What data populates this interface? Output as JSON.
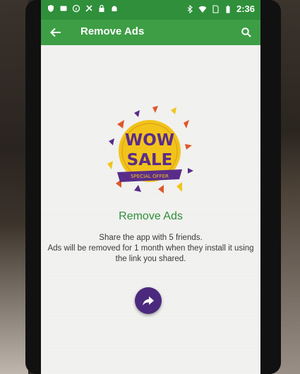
{
  "status_bar": {
    "time": "2:36",
    "left_icons": [
      "shield-icon",
      "message-icon",
      "info-icon",
      "blocked-icon",
      "lock-icon",
      "android-icon"
    ],
    "right_icons": [
      "bluetooth-icon",
      "wifi-icon",
      "no-sim-icon",
      "battery-icon"
    ]
  },
  "app_bar": {
    "title": "Remove Ads",
    "back_icon": "arrow-back-icon",
    "search_icon": "search-icon",
    "color": "#3d9e45"
  },
  "promo": {
    "line1": "WOW",
    "line2": "SALE",
    "ribbon": "SPECIAL OFFER"
  },
  "main": {
    "heading": "Remove Ads",
    "description_lines": [
      "Share the app with 5 friends.",
      "Ads will be removed for 1 month when they install it using",
      "the link you shared."
    ],
    "share_button_icon": "share-arrow-icon",
    "share_button_color": "#4b2a7e"
  }
}
